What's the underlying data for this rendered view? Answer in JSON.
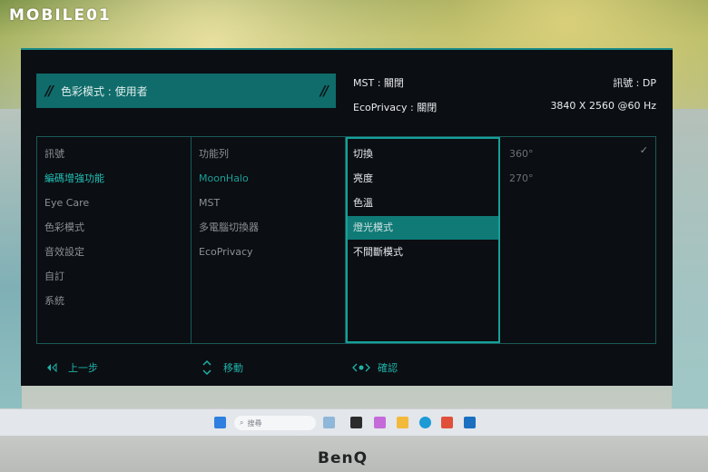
{
  "logo": "MOBILE01",
  "osd": {
    "mode_banner": {
      "slash_left": "//",
      "text": "色彩模式 : 使用者",
      "slash_right": "//"
    },
    "info": {
      "mst": "MST : 關閉",
      "signal": "訊號 : DP",
      "ecoprivacy": "EcoPrivacy : 關閉",
      "resolution": "3840 X 2560 @60 Hz"
    },
    "menu_col1": [
      {
        "label": "訊號"
      },
      {
        "label": "編碼增強功能"
      },
      {
        "label": "Eye Care"
      },
      {
        "label": "色彩模式"
      },
      {
        "label": "音效設定"
      },
      {
        "label": "自訂"
      },
      {
        "label": "系統"
      }
    ],
    "menu_col2": [
      {
        "label": "功能列"
      },
      {
        "label": "MoonHalo"
      },
      {
        "label": "MST"
      },
      {
        "label": "多電腦切換器"
      },
      {
        "label": "EcoPrivacy"
      }
    ],
    "menu_col3": [
      {
        "label": "切換"
      },
      {
        "label": "亮度"
      },
      {
        "label": "色溫"
      },
      {
        "label": "燈光模式"
      },
      {
        "label": "不間斷模式"
      }
    ],
    "menu_col4": [
      {
        "label": "360°"
      },
      {
        "label": "270°"
      }
    ],
    "check_mark": "✓",
    "footer": {
      "back": "上一步",
      "move": "移動",
      "confirm": "確認"
    }
  },
  "taskbar": {
    "search_placeholder": "搜尋"
  },
  "bezel_brand": "BenQ",
  "colors": {
    "accent": "#0f6c6a",
    "accent_bright": "#16a09a",
    "osd_bg": "#0b0e12"
  }
}
